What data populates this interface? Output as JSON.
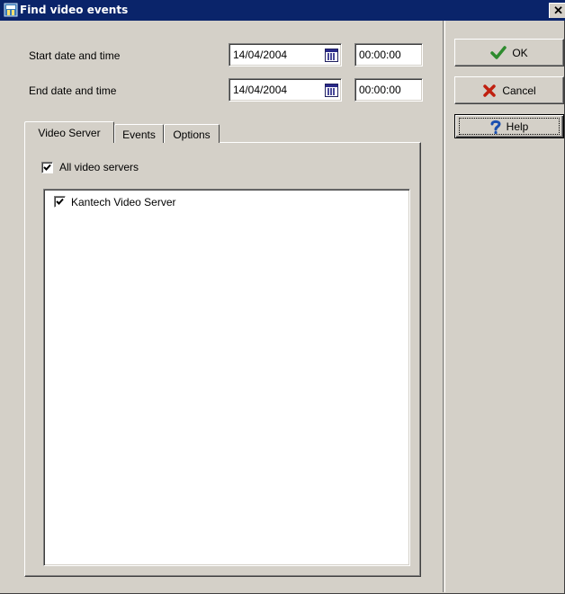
{
  "window": {
    "title": "Find video events",
    "close_glyph": "✕",
    "title_icon": "app-icon"
  },
  "form": {
    "start": {
      "label": "Start date and time",
      "date": "14/04/2004",
      "time": "00:00:00"
    },
    "end": {
      "label": "End date and time",
      "date": "14/04/2004",
      "time": "00:00:00"
    }
  },
  "tabs": [
    {
      "label": "Video Server",
      "active": true
    },
    {
      "label": "Events",
      "active": false
    },
    {
      "label": "Options",
      "active": false
    }
  ],
  "video_server_tab": {
    "all_servers": {
      "label": "All video servers",
      "checked": true
    },
    "servers": [
      {
        "label": "Kantech Video Server",
        "checked": true
      }
    ]
  },
  "buttons": {
    "ok": {
      "label": "OK",
      "icon": "checkmark-icon"
    },
    "cancel": {
      "label": "Cancel",
      "icon": "x-icon"
    },
    "help": {
      "label": "Help",
      "icon": "question-icon"
    }
  },
  "colors": {
    "titlebar": "#0a246a",
    "face": "#d4d0c8",
    "ok_check": "#2e8b2e",
    "cancel_x": "#c02010",
    "help_q": "#1a4fb0"
  }
}
